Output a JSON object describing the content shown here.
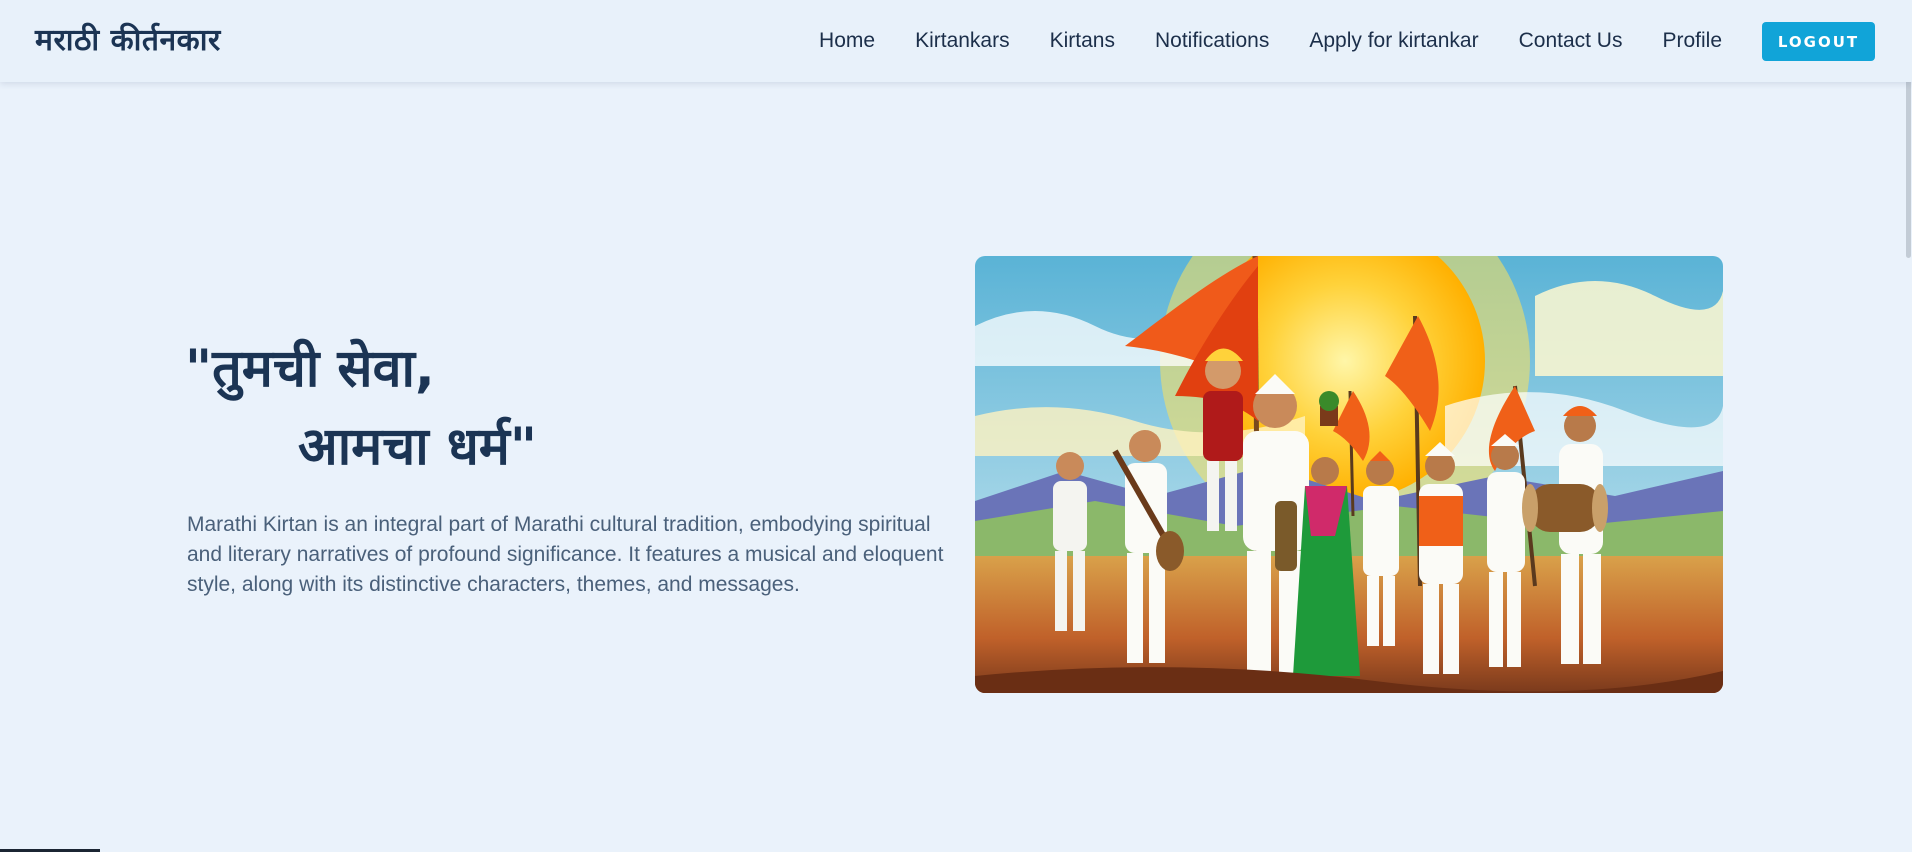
{
  "header": {
    "brand": "मराठी कीर्तनकार"
  },
  "nav": {
    "items": [
      {
        "label": "Home",
        "name": "nav-home"
      },
      {
        "label": "Kirtankars",
        "name": "nav-kirtankars"
      },
      {
        "label": "Kirtans",
        "name": "nav-kirtans"
      },
      {
        "label": "Notifications",
        "name": "nav-notifications"
      },
      {
        "label": "Apply for kirtankar",
        "name": "nav-apply-kirtankar"
      },
      {
        "label": "Contact Us",
        "name": "nav-contact-us"
      },
      {
        "label": "Profile",
        "name": "nav-profile"
      }
    ],
    "logout_label": "LOGOUT"
  },
  "hero": {
    "title_line1": "\"तुमची सेवा,",
    "title_line2": "आमचा धर्म\"",
    "description": "Marathi Kirtan is an integral part of Marathi cultural tradition, embodying spiritual and literary narratives of profound significance. It features a musical and eloquent style, along with its distinctive characters, themes, and messages."
  },
  "colors": {
    "background": "#eaf2fb",
    "brand_text": "#1b3454",
    "logout_button": "#11a4d8",
    "description_text": "#4a607a"
  }
}
